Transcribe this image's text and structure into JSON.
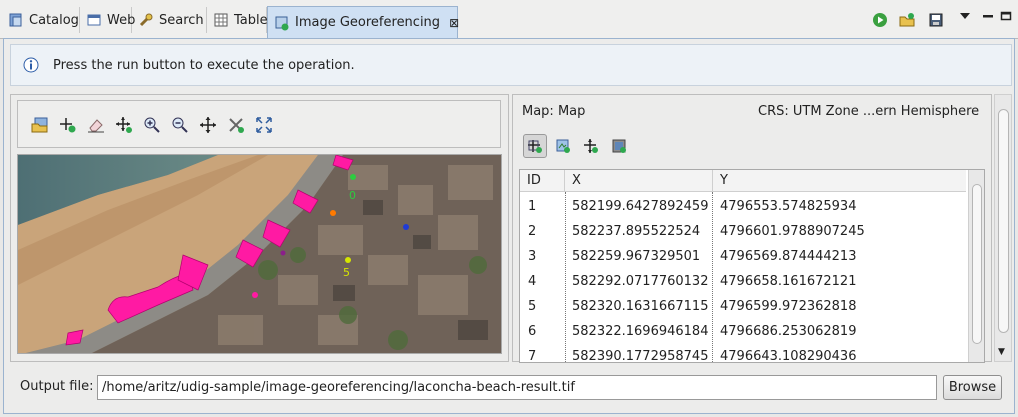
{
  "tabs": [
    {
      "label": "Catalog",
      "icon": "catalog-icon"
    },
    {
      "label": "Web",
      "icon": "web-icon"
    },
    {
      "label": "Search",
      "icon": "search-icon"
    },
    {
      "label": "Table",
      "icon": "table-icon"
    },
    {
      "label": "Image Georeferencing",
      "icon": "georeferencing-icon",
      "active": true
    }
  ],
  "view_toolbar": [
    "run-icon",
    "open-icon",
    "save-icon",
    "view-menu-icon",
    "minimize-icon",
    "maximize-icon"
  ],
  "message": {
    "icon": "info-icon",
    "text": "Press the run button to execute the operation."
  },
  "image_toolbar": [
    "open-image-icon",
    "add-point-icon",
    "erase-point-icon",
    "move-point-icon",
    "zoom-in-icon",
    "zoom-out-icon",
    "pan-icon",
    "delete-points-icon",
    "zoom-extent-icon"
  ],
  "map_panel": {
    "map_label": "Map: Map",
    "crs_label": "CRS: UTM Zone ...ern Hemisphere",
    "toolbar": [
      "add-coord-icon",
      "link-map-icon",
      "move-coord-icon",
      "map-view-icon"
    ]
  },
  "table": {
    "columns": [
      "ID",
      "X",
      "Y"
    ],
    "rows": [
      {
        "id": "1",
        "x": "582199.6427892459",
        "y": "4796553.574825934"
      },
      {
        "id": "2",
        "x": "582237.895522524",
        "y": "4796601.9788907245"
      },
      {
        "id": "3",
        "x": "582259.967329501",
        "y": "4796569.874444213"
      },
      {
        "id": "4",
        "x": "582292.0717760132",
        "y": "4796658.161672121"
      },
      {
        "id": "5",
        "x": "582320.1631667115",
        "y": "4796599.972362818"
      },
      {
        "id": "6",
        "x": "582322.1696946184",
        "y": "4796686.253062819"
      },
      {
        "id": "7",
        "x": "582390.1772958745",
        "y": "4796643.108290436"
      }
    ]
  },
  "map_point_labels": [
    "0",
    "5"
  ],
  "footer": {
    "output_label": "Output file:",
    "output_value": "/home/aritz/udig-sample/image-georeferencing/laconcha-beach-result.tif",
    "browse_label": "Browse"
  },
  "colors": {
    "accent": "#cfe0f3",
    "point_magenta": "#ff1aa3",
    "point_green": "#2ecc40",
    "point_yellow": "#d6e600",
    "point_blue": "#1f3bd6"
  }
}
